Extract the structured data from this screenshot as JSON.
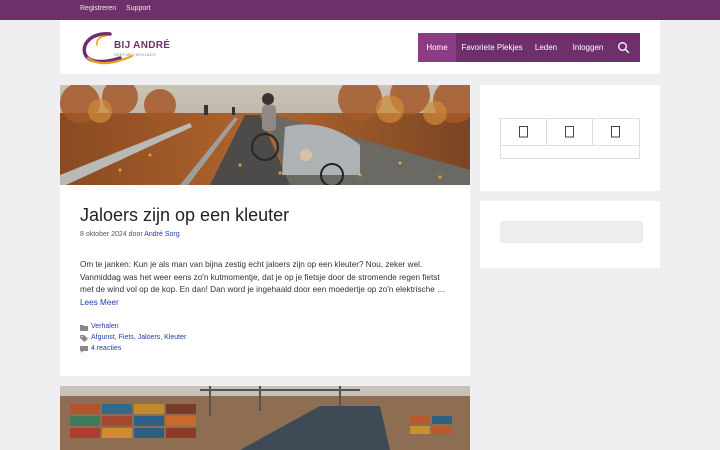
{
  "topbar": {
    "links": [
      "Registreren",
      "Support"
    ]
  },
  "header": {
    "logo_title": "BIJ ANDRÉ",
    "logo_subtitle": "GEEF MET EEN LACH",
    "nav": [
      "Home",
      "Favoriete Plekjes",
      "Leden",
      "Inloggen"
    ],
    "search_icon": "search-icon"
  },
  "post": {
    "title": "Jaloers zijn op een kleuter",
    "date": "8 oktober 2024",
    "by": "door",
    "author": "André Sorg",
    "excerpt": "Om te janken: Kun je als man van bijna zestig echt jaloers zijn op een kleuter? Nou, zeker wel. Vanmiddag was het weer eens zo'n kutmomentje, dat je op je fietsje door de stromende regen fietst met de wind vol op de kop. En dan! Dan word je ingehaald door een moedertje op zo'n elektrische …",
    "read_more": "Lees Meer",
    "category": "Verhalen",
    "tags": [
      "Afgunst",
      "Fiets",
      "Jaloers",
      "Kleuter"
    ],
    "comments": "4 reacties"
  },
  "colors": {
    "brand": "#6f2f6a",
    "link": "#1e3ea8"
  }
}
